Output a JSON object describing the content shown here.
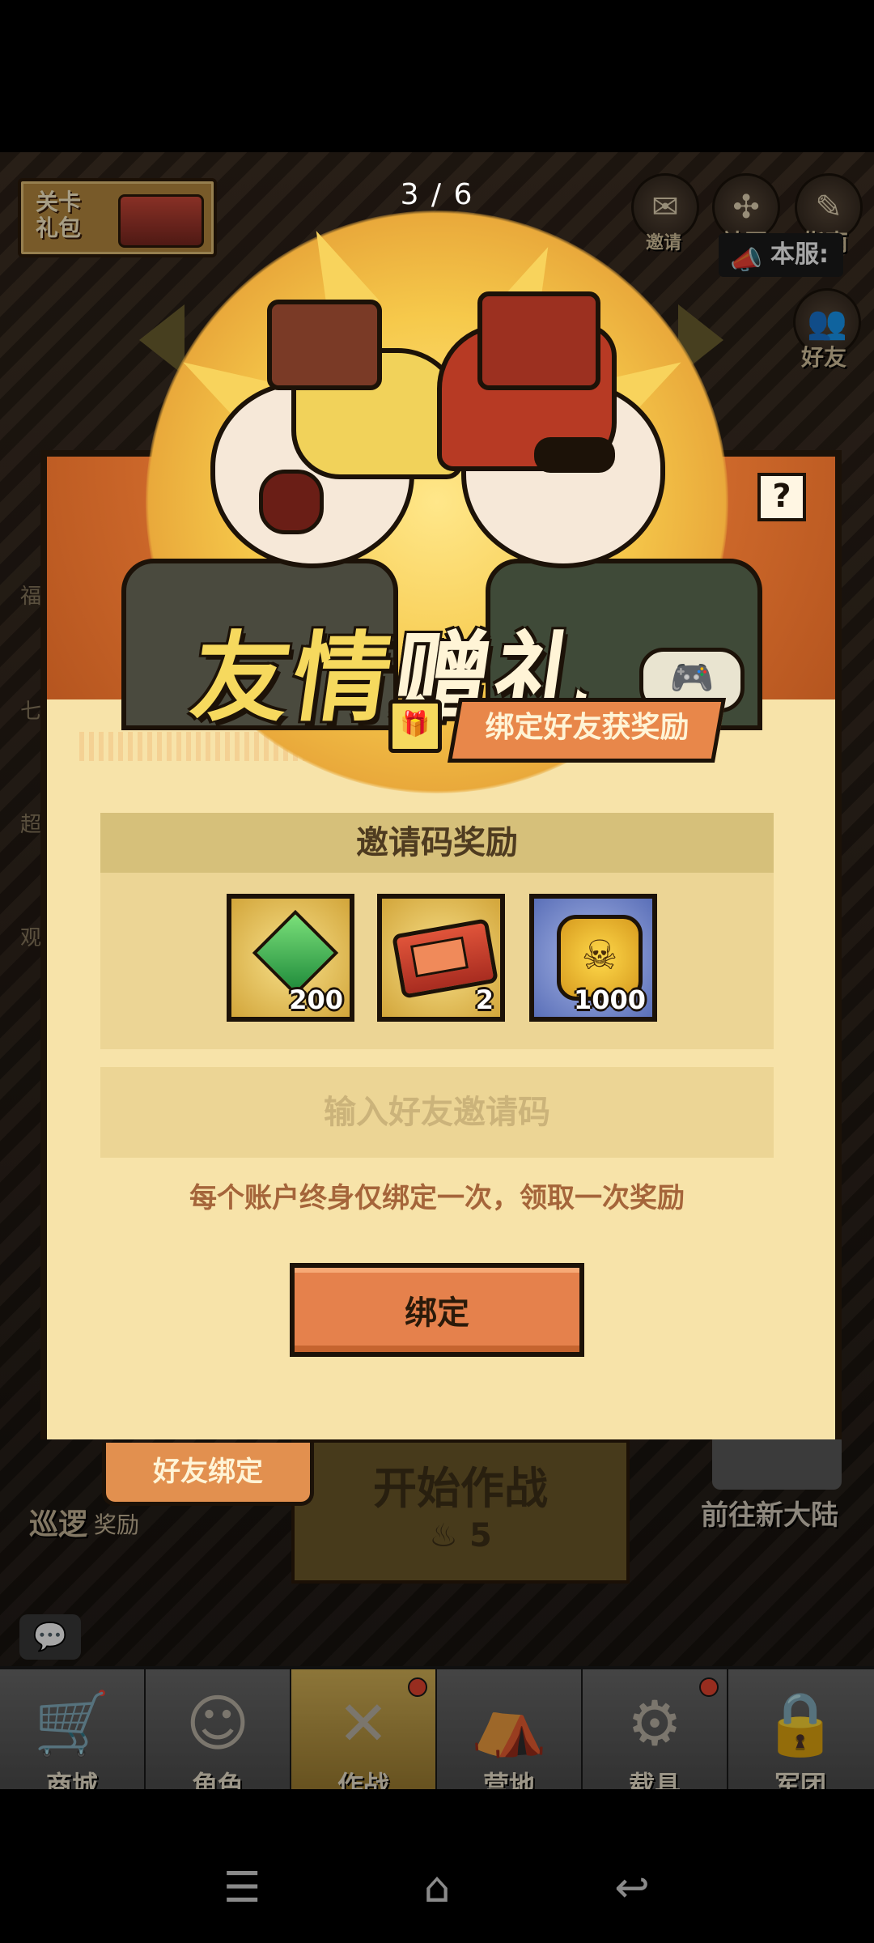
{
  "viewer": {
    "counter": "3 / 6"
  },
  "game": {
    "top_left_badge": "关卡礼包",
    "server_badge": "本服:",
    "side_buttons": [
      {
        "icon": "invite-icon",
        "label": "邀请"
      },
      {
        "icon": "community-icon",
        "label": "社区"
      },
      {
        "icon": "guide-icon",
        "label": "指南"
      },
      {
        "icon": "friends-icon",
        "label": "好友"
      }
    ],
    "left_labels": [
      "福",
      "七",
      "超",
      "观"
    ],
    "start_battle": {
      "label": "开始作战",
      "cost": "5"
    },
    "patrol": {
      "label": "巡逻",
      "reward": "奖励"
    },
    "new_continent": "前往新大陆",
    "bottom_nav": [
      {
        "label": "商城",
        "icon": "cart-icon",
        "active": false,
        "badge": false
      },
      {
        "label": "角色",
        "icon": "character-icon",
        "active": false,
        "badge": false
      },
      {
        "label": "作战",
        "icon": "crossed-guns-icon",
        "active": true,
        "badge": true
      },
      {
        "label": "营地",
        "icon": "tent-icon",
        "active": false,
        "badge": false
      },
      {
        "label": "载具",
        "icon": "excavator-icon",
        "active": false,
        "badge": true
      },
      {
        "label": "军团",
        "icon": "lock-icon",
        "active": false,
        "badge": false
      }
    ]
  },
  "popup": {
    "title_part1": "友情",
    "title_part2": "赠礼",
    "subtitle": "绑定好友获奖励",
    "help": "?",
    "reward_section_title": "邀请码奖励",
    "rewards": [
      {
        "icon": "gem-icon",
        "qty": "200"
      },
      {
        "icon": "ticket-icon",
        "qty": "2"
      },
      {
        "icon": "skull-coin-icon",
        "qty": "1000"
      }
    ],
    "input_placeholder": "输入好友邀请码",
    "input_value": "",
    "note": "每个账户终身仅绑定一次，领取一次奖励",
    "bind_button": "绑定",
    "tab_label": "好友绑定"
  },
  "colors": {
    "accent_orange": "#e5814c",
    "panel_cream": "#f7e3a9",
    "title_yellow": "#f6d95e"
  }
}
